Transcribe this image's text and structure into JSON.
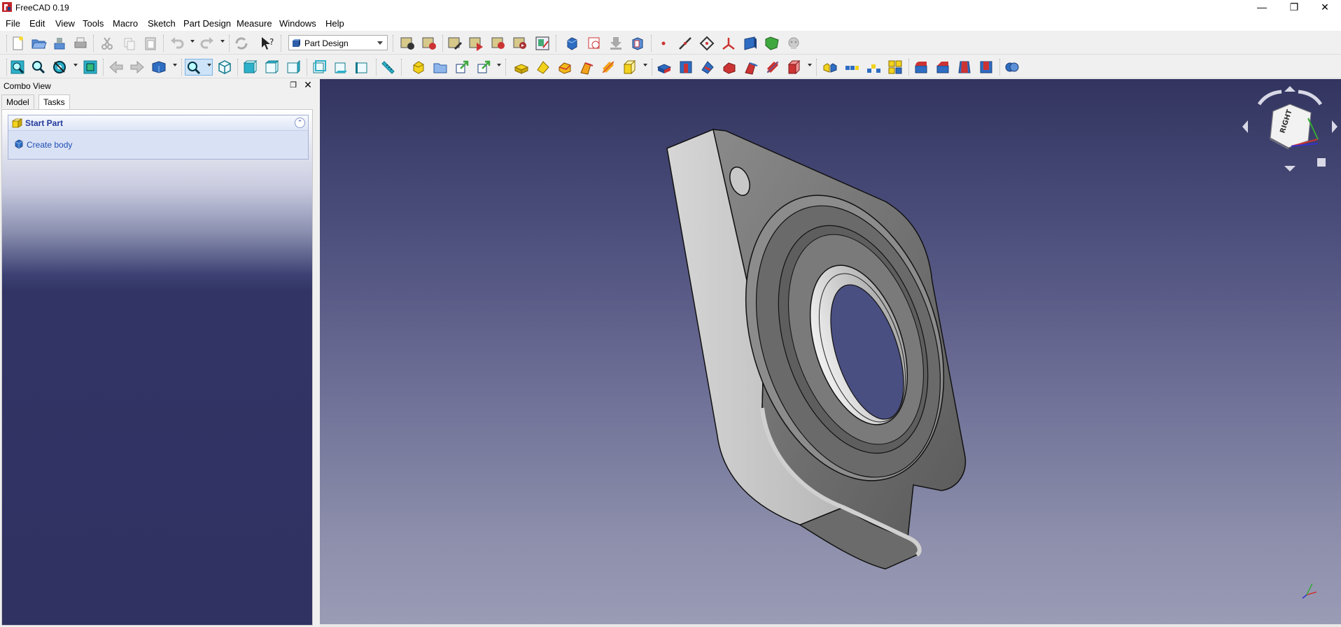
{
  "window": {
    "title": "FreeCAD 0.19",
    "controls": {
      "minimize": "—",
      "restore": "❐",
      "close": "✕"
    }
  },
  "menubar": {
    "items": [
      "File",
      "Edit",
      "View",
      "Tools",
      "Macro",
      "Sketch",
      "Part Design",
      "Measure",
      "Windows",
      "Help"
    ]
  },
  "toolbar": {
    "workbench_selected": "Part Design"
  },
  "combo_view": {
    "title": "Combo View",
    "tabs": [
      "Model",
      "Tasks"
    ],
    "active_tab": "Tasks",
    "task_panel": {
      "title": "Start Part",
      "action": "Create body"
    }
  },
  "nav_cube": {
    "face_label": "RIGHT"
  },
  "colors": {
    "viewport_top": "#333560",
    "viewport_bottom": "#9a9cb6",
    "task_header_text": "#21399a",
    "task_link": "#1e4fb5"
  },
  "icons": [
    "new-document-icon",
    "open-icon",
    "save-icon",
    "print-icon",
    "cut-icon",
    "copy-icon",
    "paste-icon",
    "undo-icon",
    "redo-icon",
    "refresh-icon",
    "whats-this-icon",
    "fit-all-icon",
    "fit-selection-icon",
    "draw-style-icon",
    "bounding-box-icon",
    "back-icon",
    "forward-icon",
    "std-views-icon",
    "zoom-icon",
    "isometric-icon",
    "front-view-icon",
    "top-view-icon",
    "right-view-icon",
    "rear-view-icon",
    "bottom-view-icon",
    "left-view-icon",
    "measure-icon",
    "pad-icon",
    "pocket-icon"
  ]
}
